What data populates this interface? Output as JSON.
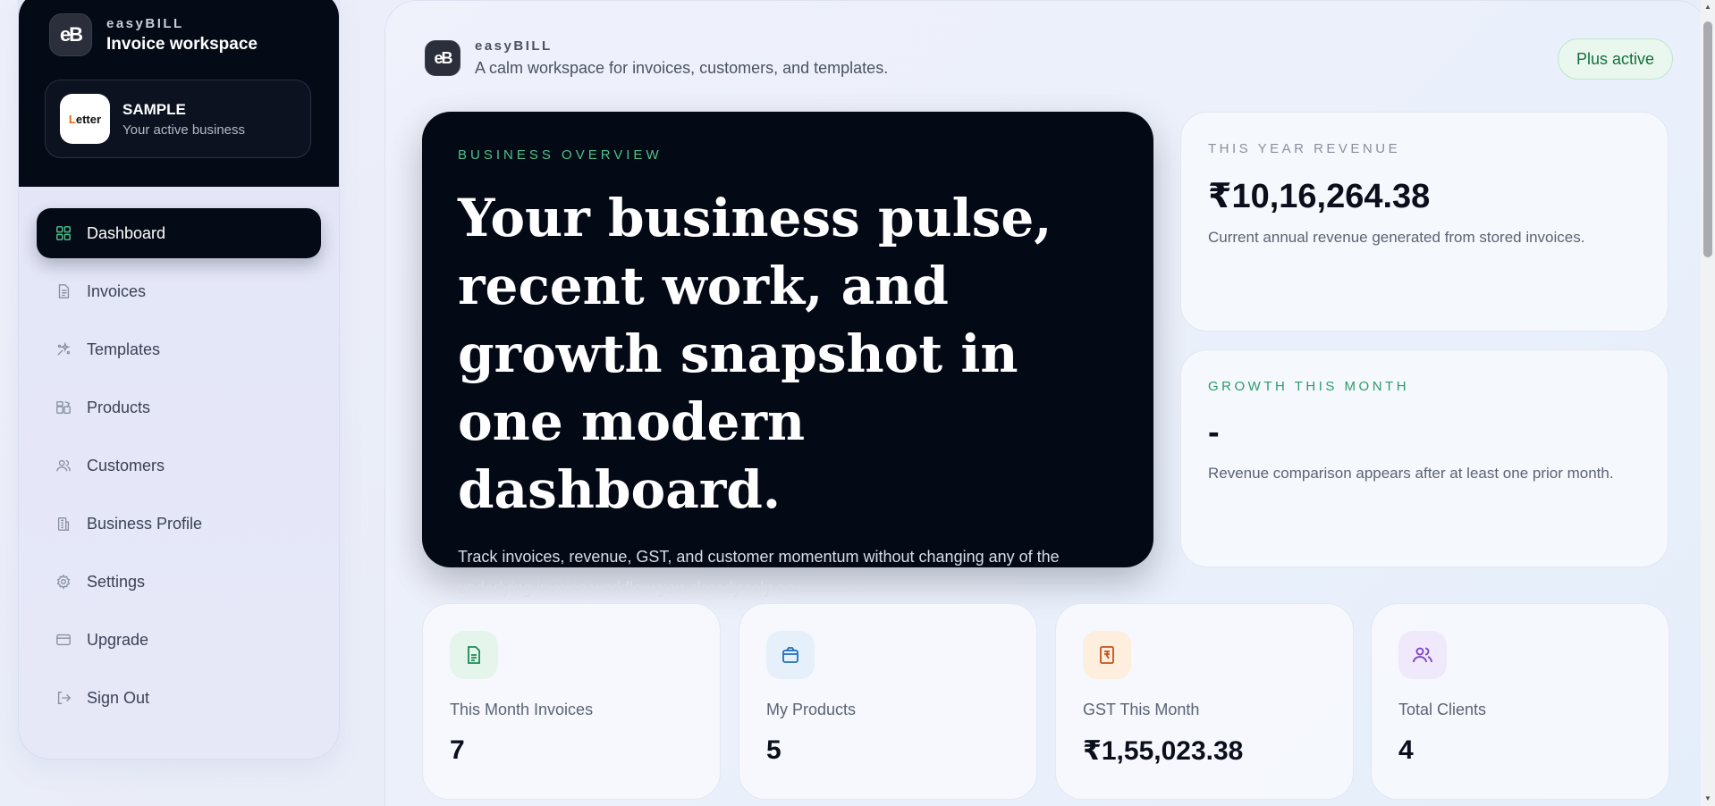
{
  "sidebar": {
    "brand_name": "easyBILL",
    "brand_sub": "Invoice workspace",
    "logo_text": "eB",
    "business": {
      "name": "SAMPLE",
      "sub": "Your active business",
      "logo_text": "Letter"
    },
    "items": [
      {
        "label": "Dashboard",
        "icon": "grid-icon",
        "active": true
      },
      {
        "label": "Invoices",
        "icon": "document-icon"
      },
      {
        "label": "Templates",
        "icon": "sparkles-icon"
      },
      {
        "label": "Products",
        "icon": "boxes-icon"
      },
      {
        "label": "Customers",
        "icon": "users-icon"
      },
      {
        "label": "Business Profile",
        "icon": "building-icon"
      },
      {
        "label": "Settings",
        "icon": "gear-icon"
      },
      {
        "label": "Upgrade",
        "icon": "card-icon"
      },
      {
        "label": "Sign Out",
        "icon": "sign-out-icon"
      }
    ]
  },
  "header": {
    "brand_name": "easyBILL",
    "tagline": "A calm workspace for invoices, customers, and templates.",
    "plan_badge": "Plus active"
  },
  "hero": {
    "eyebrow": "BUSINESS OVERVIEW",
    "title": "Your business pulse, recent work, and growth snapshot in one modern dashboard.",
    "text": "Track invoices, revenue, GST, and customer momentum without changing any of the underlying invoice workflow you already rely on."
  },
  "revenue": {
    "label": "THIS YEAR REVENUE",
    "value": "₹10,16,264.38",
    "desc": "Current annual revenue generated from stored invoices."
  },
  "growth": {
    "label": "GROWTH THIS MONTH",
    "value": "-",
    "desc": "Revenue comparison appears after at least one prior month."
  },
  "stats": [
    {
      "label": "This Month Invoices",
      "value": "7",
      "icon": "invoice-icon",
      "color": "#1a8a55",
      "bg": "#e6f5ec"
    },
    {
      "label": "My Products",
      "value": "5",
      "icon": "box-icon",
      "color": "#1f6fb8",
      "bg": "#e6f0fa"
    },
    {
      "label": "GST This Month",
      "value": "₹1,55,023.38",
      "icon": "rupee-receipt-icon",
      "color": "#c2541a",
      "bg": "#fdeedd"
    },
    {
      "label": "Total Clients",
      "value": "4",
      "icon": "users-icon",
      "color": "#7b3fc7",
      "bg": "#f0e8fb"
    }
  ],
  "colors": {
    "accent_dark": "#050a17",
    "accent_green": "#4ec38a"
  }
}
